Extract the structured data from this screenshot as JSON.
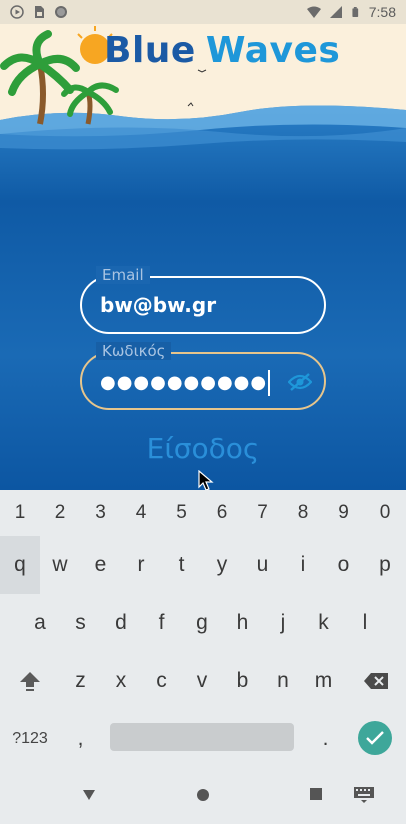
{
  "status_bar": {
    "time": "7:58",
    "icons_left": [
      "play-icon",
      "sim-card-icon",
      "circle-icon"
    ],
    "icons_right": [
      "wifi-icon",
      "signal-icon",
      "battery-icon"
    ]
  },
  "app": {
    "title_word1": "Blue",
    "title_word2": "Waves",
    "email": {
      "label": "Email",
      "value": "bw@bw.gr"
    },
    "password": {
      "label": "Κωδικός",
      "value": "●●●●●●●●●●"
    },
    "login_label": "Είσοδος"
  },
  "keyboard": {
    "numbers": [
      "1",
      "2",
      "3",
      "4",
      "5",
      "6",
      "7",
      "8",
      "9",
      "0"
    ],
    "row1": [
      "q",
      "w",
      "e",
      "r",
      "t",
      "y",
      "u",
      "i",
      "o",
      "p"
    ],
    "row2": [
      "a",
      "s",
      "d",
      "f",
      "g",
      "h",
      "j",
      "k",
      "l"
    ],
    "row3": [
      "z",
      "x",
      "c",
      "v",
      "b",
      "n",
      "m"
    ],
    "symbols_label": "?123",
    "comma": ",",
    "period": "."
  },
  "colors": {
    "sea": "#0f5ea8",
    "sand": "#fbf0dc",
    "accent": "#3ea79a"
  }
}
